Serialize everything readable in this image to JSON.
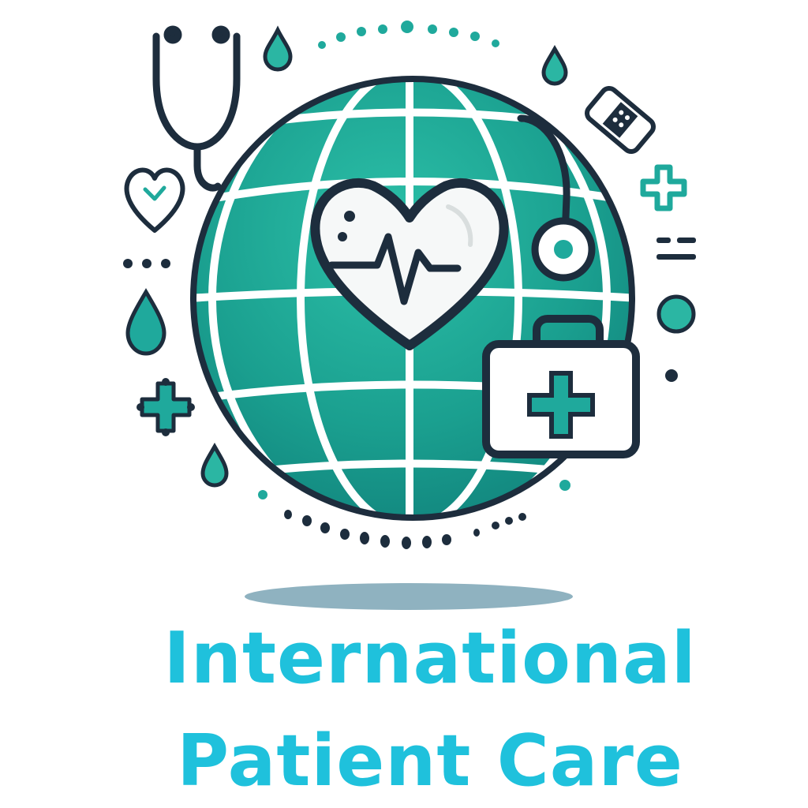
{
  "logo": {
    "title_line_1": "International",
    "title_line_2": "Patient Care"
  },
  "colors": {
    "brand_text": "#1fc1dc",
    "outline": "#1d2d3d",
    "globe_primary": "#1a9f8f",
    "globe_light": "#2bbaa2",
    "globe_dark": "#0f7f78",
    "accent_teal": "#1fa99c",
    "shadow": "#8fb2c0",
    "white": "#ffffff",
    "heart_fill": "#f6f8f8"
  },
  "icons": [
    "globe-icon",
    "heart-pulse-icon",
    "stethoscope-icon",
    "first-aid-kit-icon",
    "bandage-icon",
    "medical-cross-icon",
    "small-heart-icon",
    "water-drop-icon",
    "virus-cross-icon"
  ]
}
